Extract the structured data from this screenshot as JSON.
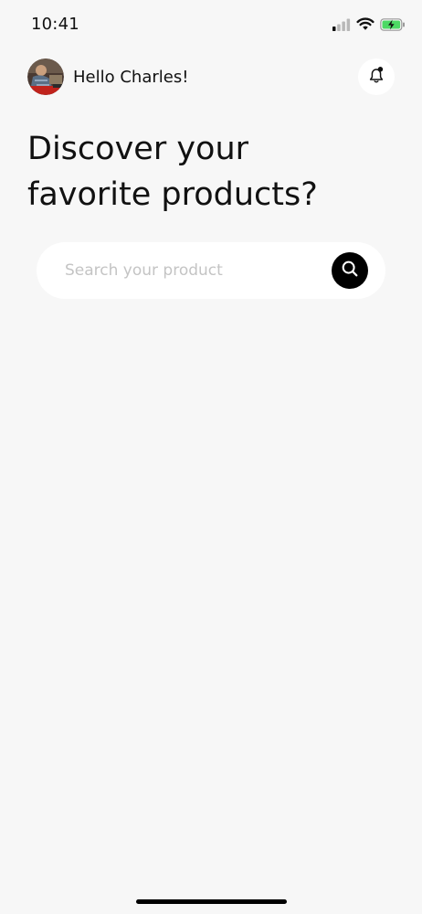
{
  "status_bar": {
    "time": "10:41",
    "icons": [
      "cellular-signal-icon",
      "wifi-icon",
      "battery-charging-icon"
    ]
  },
  "header": {
    "greeting": "Hello Charles!",
    "avatar_icon": "user-avatar",
    "notification_icon": "bell-icon"
  },
  "hero": {
    "line1": "Discover your",
    "line2": "favorite products?"
  },
  "search": {
    "placeholder": "Search your product",
    "value": "",
    "button_icon": "search-icon"
  },
  "colors": {
    "background": "#f7f7f7",
    "card": "#ffffff",
    "accent": "#000000",
    "placeholder": "#c4c4c4",
    "battery": "#4cd964"
  }
}
